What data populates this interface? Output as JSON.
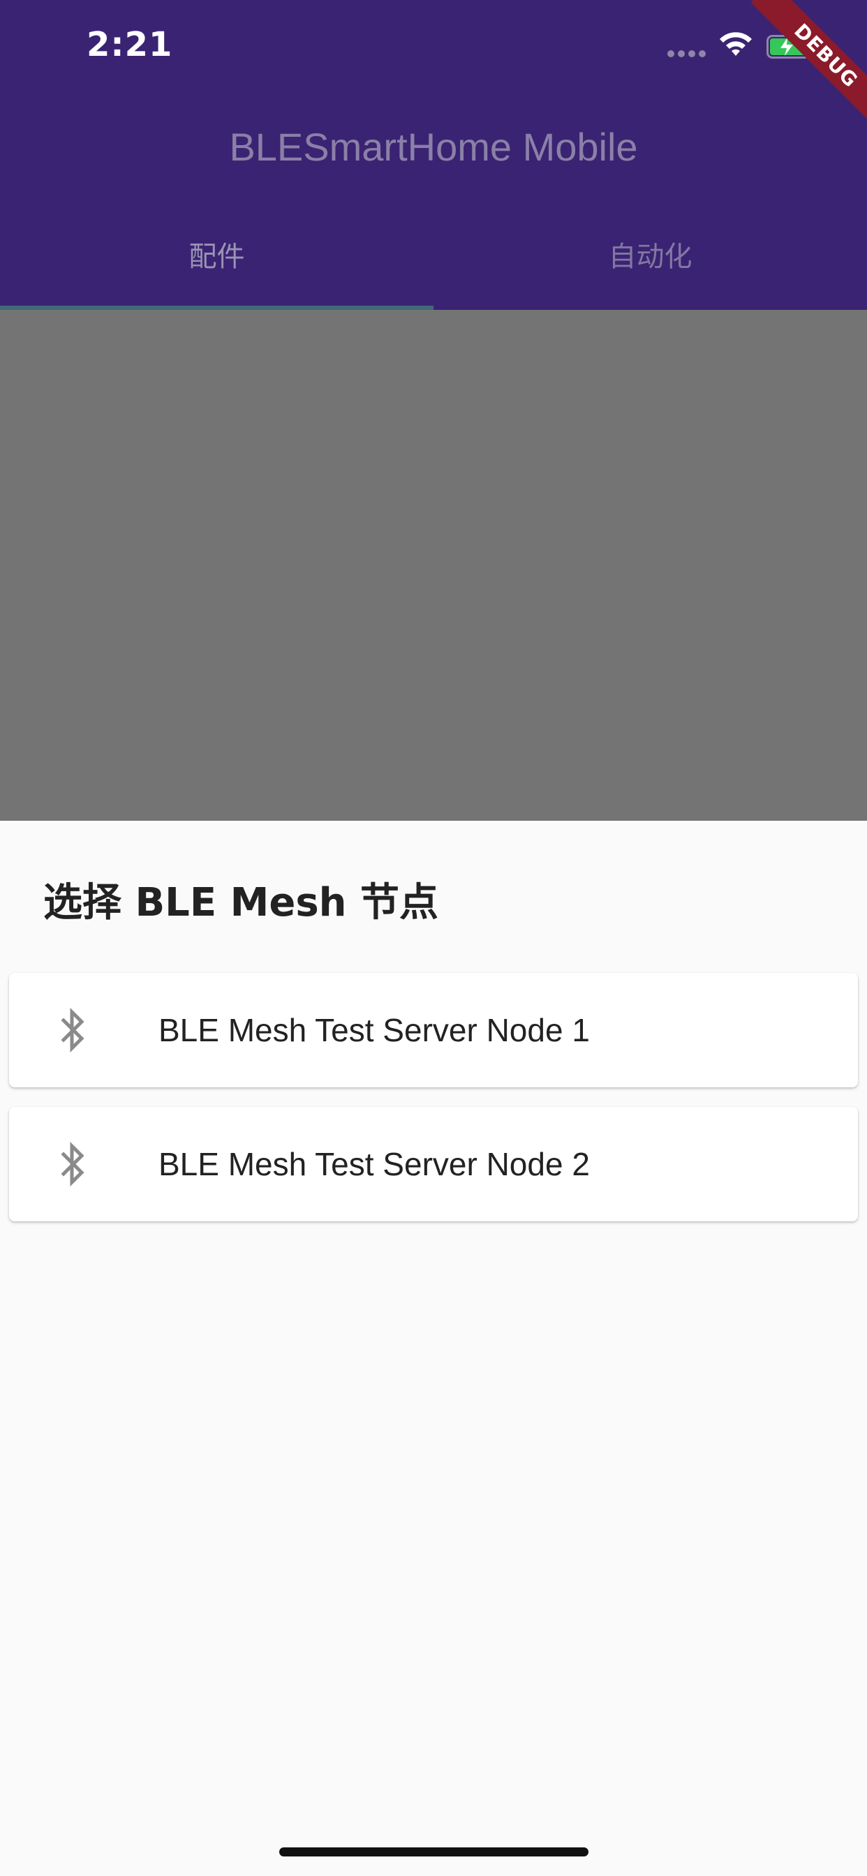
{
  "status_bar": {
    "time": "2:21"
  },
  "debug_banner": "DEBUG",
  "app_bar": {
    "title": "BLESmartHome Mobile",
    "tabs": [
      {
        "label": "配件",
        "active": true
      },
      {
        "label": "自动化",
        "active": false
      }
    ]
  },
  "bottom_sheet": {
    "title": "选择 BLE Mesh 节点",
    "nodes": [
      {
        "label": "BLE Mesh Test Server Node 1",
        "icon": "bluetooth-icon"
      },
      {
        "label": "BLE Mesh Test Server Node 2",
        "icon": "bluetooth-icon"
      }
    ]
  },
  "colors": {
    "app_bar_dimmed": "#3b2373",
    "scrim": "#747474",
    "sheet_background": "#fafafa",
    "debug_ribbon": "#8b1a2b"
  }
}
